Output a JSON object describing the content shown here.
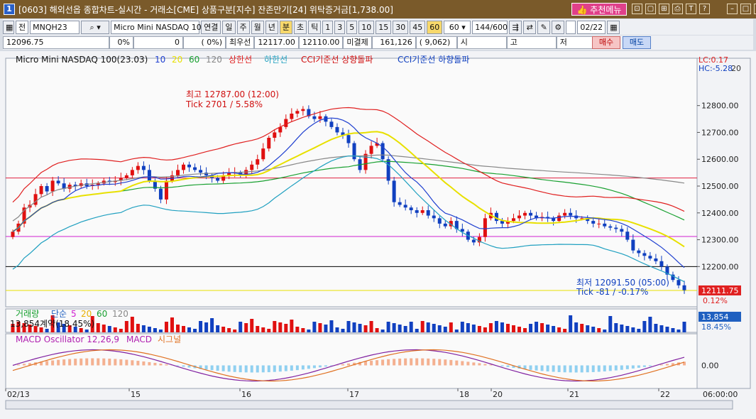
{
  "title": {
    "num": "1",
    "text": "[0603] 해외선옵 종합차트-실시간 - 거래소[CME] 상품구분[지수] 잔존만기[24] 위탁증거금[1,738.00]",
    "recommend": "추천메뉴",
    "icons": [
      "pin-icon",
      "window-icon",
      "link-icon",
      "print-icon",
      "text-icon",
      "help-icon",
      "minimize-icon",
      "maximize-icon",
      "close-icon"
    ]
  },
  "toolbar": {
    "mode": "전",
    "code": "MNQH23",
    "product": "Micro Mini NASDAQ 10",
    "periods": [
      "연결",
      "일",
      "주",
      "월",
      "년",
      "분",
      "초",
      "틱"
    ],
    "minutes": [
      "1",
      "3",
      "5",
      "10",
      "15",
      "30",
      "45",
      "60"
    ],
    "active_minute": "60",
    "interval": "60",
    "count": "144/600",
    "date": "02/22"
  },
  "info": {
    "price": "12096.75",
    "change": "0%",
    "qty": "0",
    "pct": "0%",
    "best_label": "최우선",
    "bid": "12117.00",
    "ask": "12110.00",
    "unsettled_label": "미결제",
    "unsettled": "161,126",
    "unsettled_chg": "9,062",
    "open_label": "시",
    "high_label": "고",
    "low_label": "저",
    "buy": "매수",
    "sell": "매도"
  },
  "chart_data": {
    "type": "candlestick",
    "title": "Micro Mini NASDAQ 100(23.03)",
    "ma": [
      {
        "name": "10",
        "color": "#2040d0"
      },
      {
        "name": "20",
        "color": "#e8e000"
      },
      {
        "name": "60",
        "color": "#18a030"
      },
      {
        "name": "120",
        "color": "#888888"
      }
    ],
    "bands": [
      {
        "name": "상한선",
        "color": "#e02020"
      },
      {
        "name": "하한선",
        "color": "#20a0c0"
      }
    ],
    "cci": [
      {
        "name": "CCI기준선 상향돌파",
        "color": "#d01010"
      },
      {
        "name": "CCI기준선 하향돌파",
        "color": "#1040c0"
      }
    ],
    "ylim": [
      12050,
      12950
    ],
    "yticks": [
      "12800.00",
      "12700.00",
      "12600.00",
      "12500.00",
      "12400.00",
      "12300.00",
      "12200.00"
    ],
    "xticks": [
      "02/13",
      "15",
      "16",
      "17",
      "18",
      "20",
      "21",
      "22"
    ],
    "time": "06:00:00",
    "high_note": "최고 12787.00 (12:00)",
    "high_tick": "Tick 2701 / 5.58%",
    "low_note": "최저 12091.50 (05:00)",
    "low_tick": "Tick -81 / -0.17%",
    "last": "12111.75",
    "last_pct": "0.12%",
    "lc": "LC:0.17",
    "hc": "HC:-5.28",
    "hc_val": "20",
    "hlines": [
      {
        "y": 12530,
        "color": "#e02040"
      },
      {
        "y": 12312,
        "color": "#d020d0"
      },
      {
        "y": 12200,
        "color": "#000000"
      },
      {
        "y": 12111,
        "color": "#e8e000"
      }
    ],
    "closes": [
      12330,
      12360,
      12420,
      12430,
      12470,
      12500,
      12480,
      12520,
      12510,
      12490,
      12505,
      12500,
      12510,
      12500,
      12505,
      12510,
      12520,
      12515,
      12520,
      12530,
      12540,
      12560,
      12575,
      12560,
      12520,
      12490,
      12450,
      12520,
      12540,
      12560,
      12580,
      12570,
      12560,
      12550,
      12540,
      12530,
      12520,
      12540,
      12550,
      12550,
      12540,
      12560,
      12580,
      12600,
      12640,
      12680,
      12700,
      12720,
      12750,
      12770,
      12780,
      12787,
      12760,
      12750,
      12760,
      12740,
      12720,
      12700,
      12690,
      12660,
      12600,
      12560,
      12620,
      12650,
      12660,
      12600,
      12520,
      12440,
      12430,
      12420,
      12410,
      12400,
      12410,
      12390,
      12380,
      12360,
      12350,
      12370,
      12340,
      12330,
      12300,
      12290,
      12310,
      12380,
      12400,
      12370,
      12360,
      12370,
      12380,
      12390,
      12400,
      12390,
      12380,
      12385,
      12380,
      12370,
      12390,
      12400,
      12390,
      12380,
      12380,
      12370,
      12360,
      12360,
      12350,
      12345,
      12340,
      12330,
      12300,
      12260,
      12250,
      12240,
      12230,
      12220,
      12200,
      12170,
      12150,
      12130,
      12112
    ],
    "volume": {
      "label": "거래량",
      "ma_label": "단순",
      "mas": [
        "5",
        "20",
        "60",
        "120"
      ],
      "contract_note": "13,854계약(18.45%)",
      "last": "13,854",
      "pct": "18.45%"
    },
    "macd": {
      "label": "MACD Oscillator 12,26,9",
      "macd": "MACD",
      "signal": "시그널",
      "zero": "0.00"
    }
  }
}
